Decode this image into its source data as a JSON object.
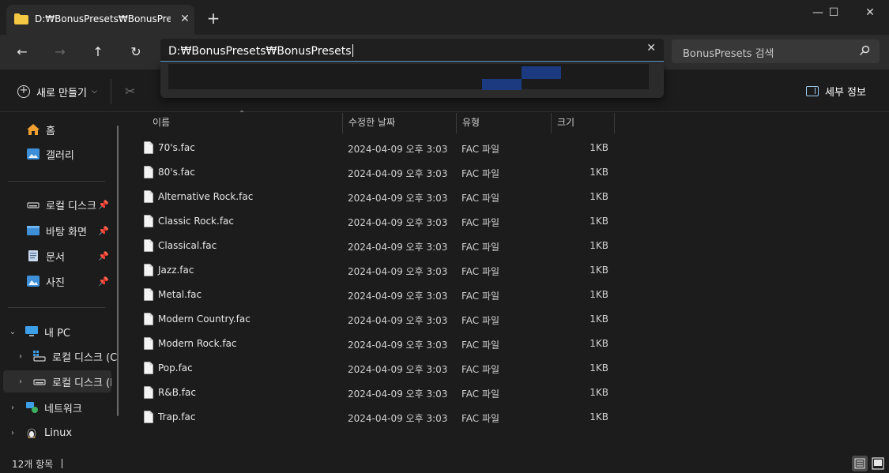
{
  "tab": {
    "title": "D:₩BonusPresets₩BonusPresets"
  },
  "window_buttons": {
    "minimize": "—",
    "maximize": "☐",
    "close": "✕"
  },
  "nav": {
    "back": "←",
    "forward": "→",
    "up": "↑",
    "refresh": "↻"
  },
  "address": {
    "value": "D:₩BonusPresets₩BonusPresets"
  },
  "search": {
    "placeholder": "BonusPresets 검색"
  },
  "commandbar": {
    "new_label": "새로 만들기",
    "details_label": "세부 정보"
  },
  "sidebar": {
    "items": [
      {
        "label": "홈",
        "icon": "home-icon"
      },
      {
        "label": "갤러리",
        "icon": "gallery-icon"
      },
      {
        "label": "로컬 디스크",
        "icon": "drive-icon",
        "pinned": true
      },
      {
        "label": "바탕 화면",
        "icon": "desktop-icon",
        "pinned": true
      },
      {
        "label": "문서",
        "icon": "documents-icon",
        "pinned": true
      },
      {
        "label": "사진",
        "icon": "pictures-icon",
        "pinned": true
      },
      {
        "label": "내 PC",
        "icon": "pc-icon",
        "expanded": true
      },
      {
        "label": "로컬 디스크 (C",
        "icon": "drive-c-icon"
      },
      {
        "label": "로컬 디스크 (D",
        "icon": "drive-d-icon",
        "selected": true
      },
      {
        "label": "네트워크",
        "icon": "network-icon"
      },
      {
        "label": "Linux",
        "icon": "linux-icon"
      }
    ]
  },
  "columns": {
    "name": "이름",
    "modified": "수정한 날짜",
    "type": "유형",
    "size": "크기"
  },
  "files": [
    {
      "name": "70's.fac",
      "modified": "2024-04-09 오후 3:03",
      "type": "FAC 파일",
      "size": "1KB"
    },
    {
      "name": "80's.fac",
      "modified": "2024-04-09 오후 3:03",
      "type": "FAC 파일",
      "size": "1KB"
    },
    {
      "name": "Alternative Rock.fac",
      "modified": "2024-04-09 오후 3:03",
      "type": "FAC 파일",
      "size": "1KB"
    },
    {
      "name": "Classic Rock.fac",
      "modified": "2024-04-09 오후 3:03",
      "type": "FAC 파일",
      "size": "1KB"
    },
    {
      "name": "Classical.fac",
      "modified": "2024-04-09 오후 3:03",
      "type": "FAC 파일",
      "size": "1KB"
    },
    {
      "name": "Jazz.fac",
      "modified": "2024-04-09 오후 3:03",
      "type": "FAC 파일",
      "size": "1KB"
    },
    {
      "name": "Metal.fac",
      "modified": "2024-04-09 오후 3:03",
      "type": "FAC 파일",
      "size": "1KB"
    },
    {
      "name": "Modern Country.fac",
      "modified": "2024-04-09 오후 3:03",
      "type": "FAC 파일",
      "size": "1KB"
    },
    {
      "name": "Modern Rock.fac",
      "modified": "2024-04-09 오후 3:03",
      "type": "FAC 파일",
      "size": "1KB"
    },
    {
      "name": "Pop.fac",
      "modified": "2024-04-09 오후 3:03",
      "type": "FAC 파일",
      "size": "1KB"
    },
    {
      "name": "R&B.fac",
      "modified": "2024-04-09 오후 3:03",
      "type": "FAC 파일",
      "size": "1KB"
    },
    {
      "name": "Trap.fac",
      "modified": "2024-04-09 오후 3:03",
      "type": "FAC 파일",
      "size": "1KB"
    }
  ],
  "status": {
    "count": "12개 항목"
  },
  "colors": {
    "accent": "#60a8e0",
    "selection": "#1b3a80",
    "background": "#1c1c1c"
  }
}
